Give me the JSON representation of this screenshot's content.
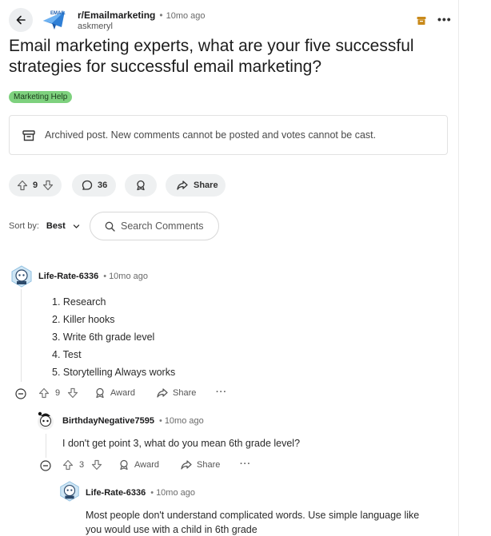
{
  "header": {
    "subreddit": "r/Emailmarketing",
    "time": "10mo ago",
    "author": "askmeryl",
    "avatar_text": "EMAIL"
  },
  "post": {
    "title": "Email marketing experts, what are your five successful strategies for successful email marketing?",
    "flair": "Marketing Help",
    "archived_notice": "Archived post. New comments cannot be posted and votes cannot be cast.",
    "votes": "9",
    "comments": "36",
    "share_label": "Share"
  },
  "sort": {
    "label": "Sort by:",
    "value": "Best"
  },
  "search": {
    "placeholder": "Search Comments"
  },
  "comments": [
    {
      "user": "Life-Rate-6336",
      "time": "10mo ago",
      "lines": [
        "1. Research",
        "2. Killer hooks",
        "3. Write 6th grade level",
        "4. Test",
        "5. Storytelling Always works"
      ],
      "votes": "9",
      "award_label": "Award",
      "share_label": "Share"
    },
    {
      "user": "BirthdayNegative7595",
      "time": "10mo ago",
      "lines": [
        "I don't get point 3, what do you mean 6th grade level?"
      ],
      "votes": "3",
      "award_label": "Award",
      "share_label": "Share"
    },
    {
      "user": "Life-Rate-6336",
      "time": "10mo ago",
      "lines": [
        "Most people don't understand complicated words. Use simple language like",
        "you would use with a child in 6th grade"
      ]
    }
  ],
  "colors": {
    "flair_bg": "#7ed17e",
    "pill_bg": "#eef0f1",
    "archive_icon": "#c98a1b"
  },
  "icons": [
    "back-arrow-icon",
    "archive-icon",
    "more-icon",
    "upvote-icon",
    "downvote-icon",
    "comment-icon",
    "award-icon",
    "share-icon",
    "search-icon",
    "chevron-down-icon",
    "collapse-icon"
  ]
}
